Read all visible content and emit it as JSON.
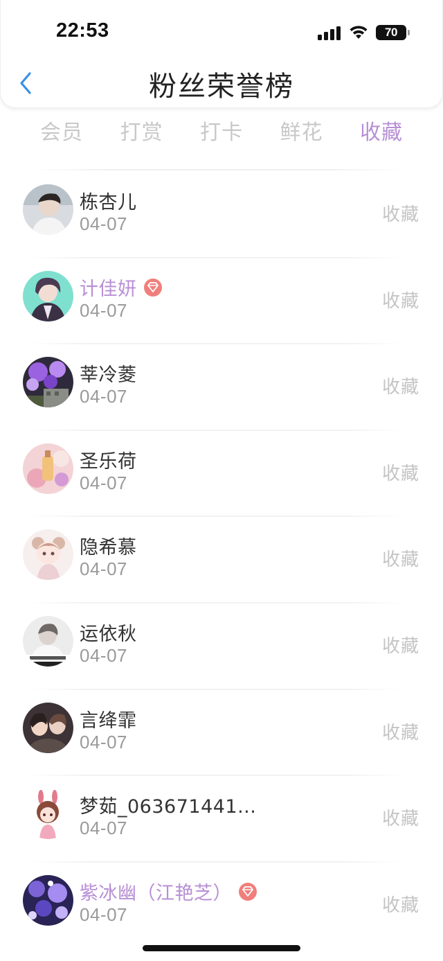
{
  "status_bar": {
    "time": "22:53",
    "battery": "70"
  },
  "nav": {
    "title": "粉丝荣誉榜",
    "back_icon": "chevron-left-icon"
  },
  "colors": {
    "accent": "#b88fd6",
    "gem": "#f07f7c",
    "back": "#3a8fe8"
  },
  "tabs": [
    {
      "label": "会员",
      "active": false
    },
    {
      "label": "打赏",
      "active": false
    },
    {
      "label": "打卡",
      "active": false
    },
    {
      "label": "鲜花",
      "active": false
    },
    {
      "label": "收藏",
      "active": true
    }
  ],
  "fans": [
    {
      "name": "栋杏儿",
      "date": "04-07",
      "action": "收藏",
      "vip": false
    },
    {
      "name": "计佳妍",
      "date": "04-07",
      "action": "收藏",
      "vip": true
    },
    {
      "name": "莘冷菱",
      "date": "04-07",
      "action": "收藏",
      "vip": false
    },
    {
      "name": "圣乐荷",
      "date": "04-07",
      "action": "收藏",
      "vip": false
    },
    {
      "name": "隐希慕",
      "date": "04-07",
      "action": "收藏",
      "vip": false
    },
    {
      "name": "运依秋",
      "date": "04-07",
      "action": "收藏",
      "vip": false
    },
    {
      "name": "言绛霏",
      "date": "04-07",
      "action": "收藏",
      "vip": false
    },
    {
      "name": "梦茹_063671441...",
      "date": "04-07",
      "action": "收藏",
      "vip": false
    },
    {
      "name": "紫冰幽（江艳芝）",
      "date": "04-07",
      "action": "收藏",
      "vip": true
    }
  ]
}
